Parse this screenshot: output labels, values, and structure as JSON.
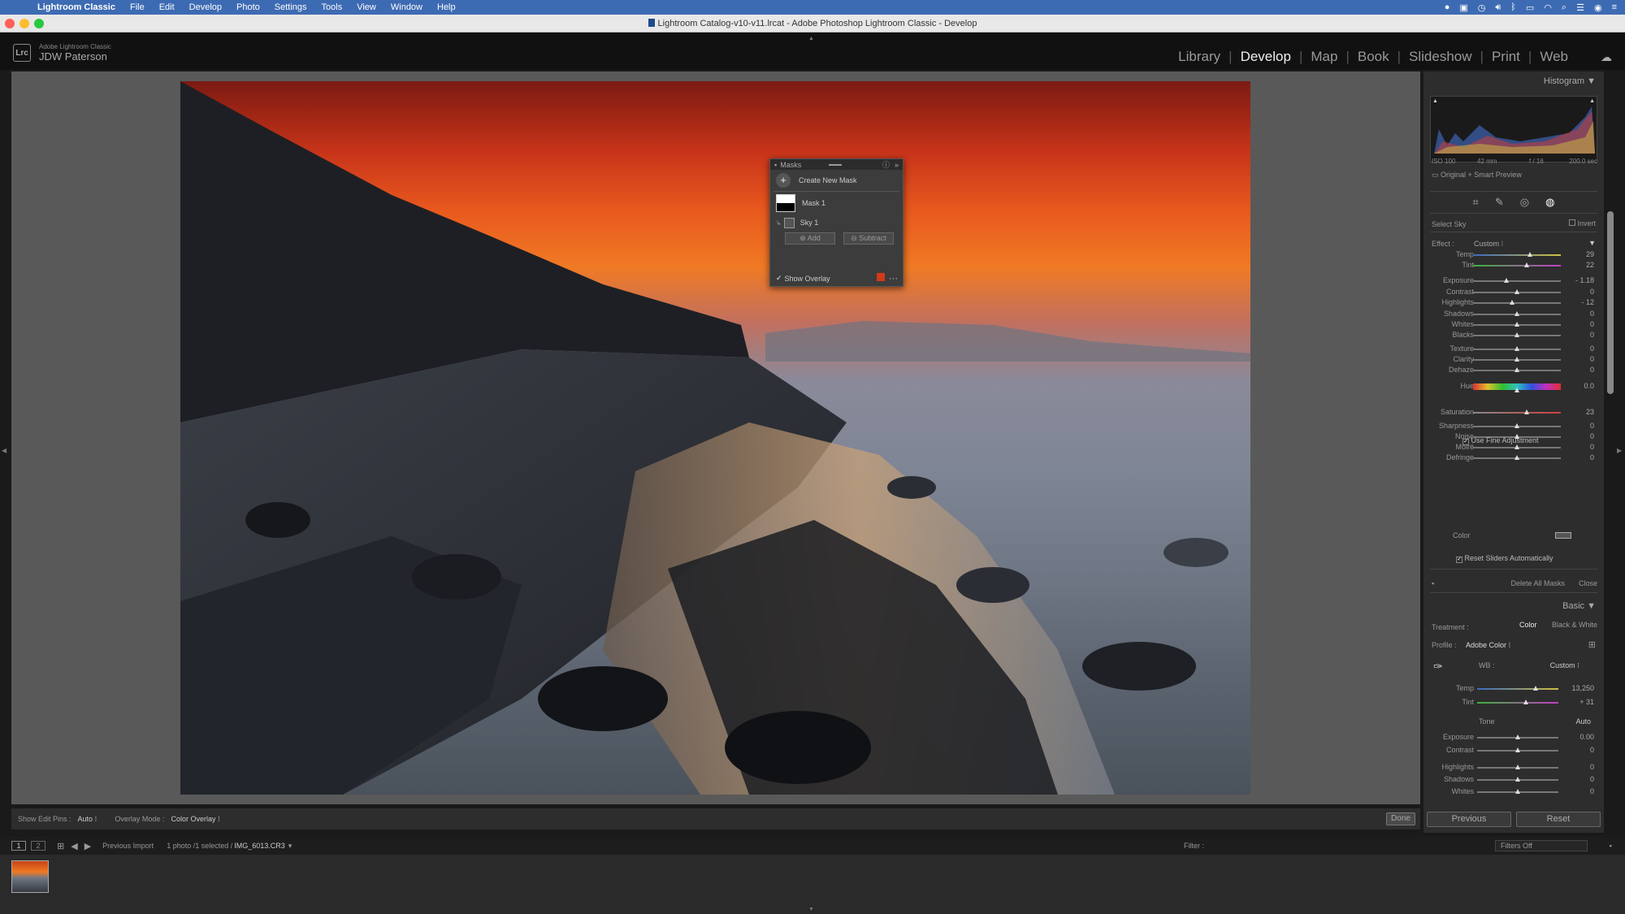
{
  "menubar": {
    "app_name": "Lightroom Classic",
    "items": [
      "File",
      "Edit",
      "Develop",
      "Photo",
      "Settings",
      "Tools",
      "View",
      "Window",
      "Help"
    ]
  },
  "window": {
    "title": "Lightroom Catalog-v10-v11.lrcat - Adobe Photoshop Lightroom Classic - Develop"
  },
  "identity": {
    "logo": "Lrc",
    "product": "Adobe Lightroom Classic",
    "user": "JDW Paterson"
  },
  "modules": [
    "Library",
    "Develop",
    "Map",
    "Book",
    "Slideshow",
    "Print",
    "Web"
  ],
  "active_module": "Develop",
  "masks_panel": {
    "title": "Masks",
    "create_label": "Create New Mask",
    "mask_name": "Mask 1",
    "component_name": "Sky 1",
    "add_label": "Add",
    "subtract_label": "Subtract",
    "show_overlay_label": "Show Overlay",
    "overlay_color": "#d23a18"
  },
  "center_toolbar": {
    "edit_pins_label": "Show Edit Pins :",
    "edit_pins_value": "Auto",
    "overlay_mode_label": "Overlay Mode :",
    "overlay_mode_value": "Color Overlay",
    "done_label": "Done"
  },
  "filmstrip_bar": {
    "source": "Previous Import",
    "count": "1 photo /1 selected /",
    "filename": "IMG_6013.CR3",
    "filter_label": "Filter :",
    "filter_value": "Filters Off"
  },
  "right_panel": {
    "histogram_title": "Histogram",
    "iso": "ISO 100",
    "focal": "42 mm",
    "aperture": "f / 16",
    "shutter": "200.0 sec",
    "preview_label": "Original + Smart Preview",
    "mask_type": "Select Sky",
    "invert_label": "Invert",
    "effect_label": "Effect :",
    "effect_value": "Custom",
    "mask_sliders": [
      {
        "label": "Temp",
        "value": "29",
        "pos": 0.645
      },
      {
        "label": "Tint",
        "value": "22",
        "pos": 0.61
      },
      {
        "label": "Exposure",
        "value": "- 1.18",
        "pos": 0.38
      },
      {
        "label": "Contrast",
        "value": "0",
        "pos": 0.5
      },
      {
        "label": "Highlights",
        "value": "- 12",
        "pos": 0.44
      },
      {
        "label": "Shadows",
        "value": "0",
        "pos": 0.5
      },
      {
        "label": "Whites",
        "value": "0",
        "pos": 0.5
      },
      {
        "label": "Blacks",
        "value": "0",
        "pos": 0.5
      },
      {
        "label": "Texture",
        "value": "0",
        "pos": 0.5
      },
      {
        "label": "Clarity",
        "value": "0",
        "pos": 0.5
      },
      {
        "label": "Dehaze",
        "value": "0",
        "pos": 0.5
      },
      {
        "label": "Hue",
        "value": "0.0",
        "pos": 0.5
      },
      {
        "label": "Saturation",
        "value": "23",
        "pos": 0.615
      },
      {
        "label": "Sharpness",
        "value": "0",
        "pos": 0.5
      },
      {
        "label": "Noise",
        "value": "0",
        "pos": 0.5
      },
      {
        "label": "Moiré",
        "value": "0",
        "pos": 0.5
      },
      {
        "label": "Defringe",
        "value": "0",
        "pos": 0.5
      }
    ],
    "fine_adjust_label": "Use Fine Adjustment",
    "color_label": "Color",
    "reset_sliders_label": "Reset Sliders Automatically",
    "delete_all_label": "Delete All Masks",
    "close_label": "Close",
    "basic_title": "Basic",
    "treatment_label": "Treatment :",
    "treatment_color": "Color",
    "treatment_bw": "Black & White",
    "profile_label": "Profile :",
    "profile_value": "Adobe Color",
    "wb_label": "WB :",
    "wb_value": "Custom",
    "basic_wb_sliders": [
      {
        "label": "Temp",
        "value": "13,250",
        "pos": 0.72
      },
      {
        "label": "Tint",
        "value": "+ 31",
        "pos": 0.6
      }
    ],
    "tone_label": "Tone",
    "auto_label": "Auto",
    "basic_tone_sliders": [
      {
        "label": "Exposure",
        "value": "0.00",
        "pos": 0.5
      },
      {
        "label": "Contrast",
        "value": "0",
        "pos": 0.5
      },
      {
        "label": "Highlights",
        "value": "0",
        "pos": 0.5
      },
      {
        "label": "Shadows",
        "value": "0",
        "pos": 0.5
      },
      {
        "label": "Whites",
        "value": "0",
        "pos": 0.5
      }
    ],
    "previous_label": "Previous",
    "reset_label": "Reset"
  }
}
